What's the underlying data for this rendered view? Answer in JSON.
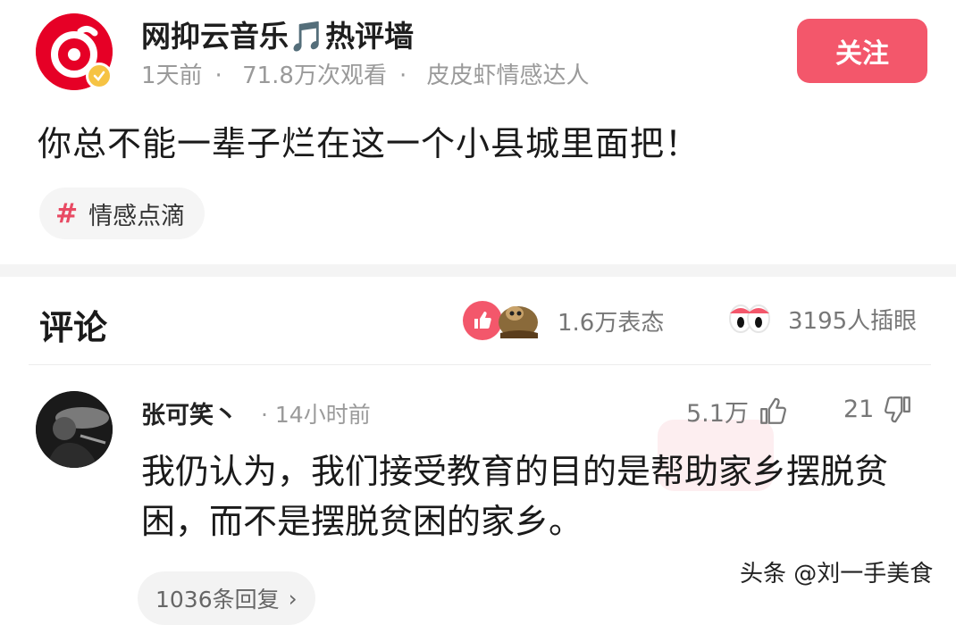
{
  "post": {
    "author": "网抑云音乐🎵热评墙",
    "time": "1天前",
    "views": "71.8万次观看",
    "source": "皮皮虾情感达人",
    "follow_label": "关注",
    "text": "你总不能一辈子烂在这一个小县城里面把！",
    "tag_icon": "#",
    "tag": "情感点滴"
  },
  "comments_section": {
    "title": "评论",
    "reactions_count": "1.6万表态",
    "eyes_count": "3195人插眼"
  },
  "comment": {
    "author": "张可笑丶",
    "time": "· 14小时前",
    "likes": "5.1万",
    "dislikes": "21",
    "text": "我仍认为，我们接受教育的目的是帮助家乡摆脱贫困，而不是摆脱贫困的家乡。",
    "replies": "1036条回复",
    "replies_chevron": "›"
  },
  "watermark": "头条 @刘一手美食",
  "colors": {
    "accent": "#f3576b",
    "brand_red": "#e60026",
    "muted_text": "#9a9a9a"
  },
  "icons": [
    "verified-badge-icon",
    "thumbs-up-icon",
    "thumbs-down-icon",
    "eyes-icon",
    "hashtag-icon"
  ]
}
